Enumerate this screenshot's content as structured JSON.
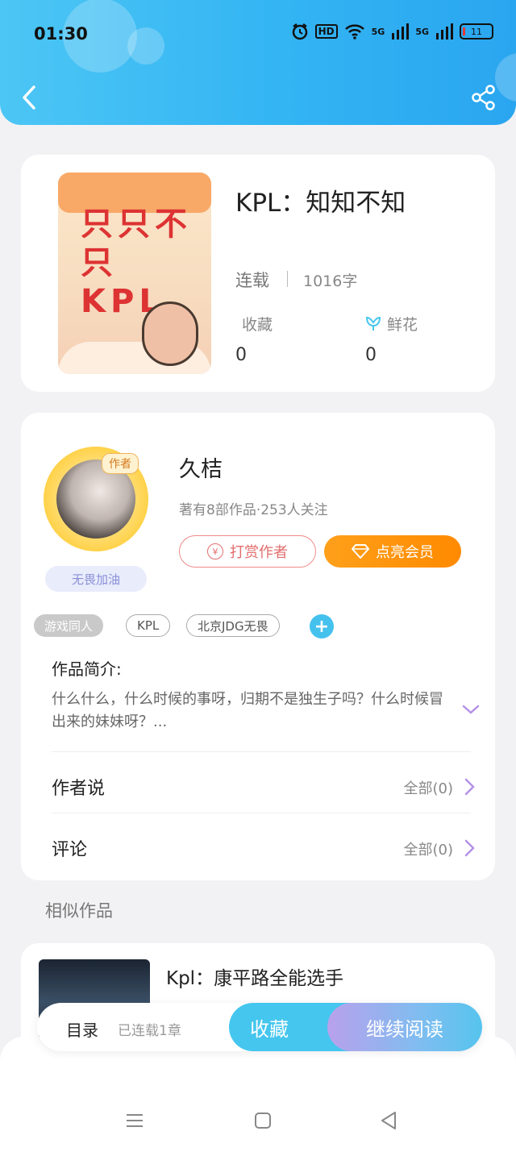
{
  "status_bar": {
    "time": "01:30",
    "network_hd": "HD",
    "network_5g_1": "5G",
    "network_5g_2": "5G",
    "battery": "11"
  },
  "header": {
    "back_icon": "chevron-left-icon",
    "share_icon": "share-icon"
  },
  "book": {
    "title": "KPL：知知不知",
    "status": "连载",
    "word_count": "1016字",
    "cover_art_text": "只只不只 KPL",
    "favorites_label": "收藏",
    "favorites_value": "0",
    "flowers_label": "鲜花",
    "flowers_value": "0"
  },
  "author": {
    "name": "久桔",
    "meta": "著有8部作品·253人关注",
    "badge": "作者",
    "motto": "无畏加油",
    "tip_button": "打赏作者",
    "vip_button": "点亮会员"
  },
  "tags": [
    {
      "label": "游戏同人"
    },
    {
      "label": "KPL"
    },
    {
      "label": "北京JDG无畏"
    }
  ],
  "intro": {
    "title": "作品简介:",
    "text": "什么什么，什么时候的事呀，归期不是独生子吗？什么时候冒出来的妹妹呀？..."
  },
  "rows": {
    "author_says_label": "作者说",
    "author_says_count": "全部(0)",
    "comments_label": "评论",
    "comments_count": "全部(0)"
  },
  "similar": {
    "section_title": "相似作品",
    "items": [
      {
        "title": "Kpl：康平路全能选手"
      }
    ]
  },
  "action_bar": {
    "toc_label": "目录",
    "toc_status": "已连载1章",
    "favorite_button": "收藏",
    "continue_button": "继续阅读"
  },
  "colors": {
    "header_start": "#4cc6f4",
    "header_end": "#2aa6f0",
    "accent_blue": "#45c6ee",
    "vip_orange": "#ff8a00",
    "tip_red": "#e26d6d",
    "chevron_purple": "#b492e6"
  }
}
